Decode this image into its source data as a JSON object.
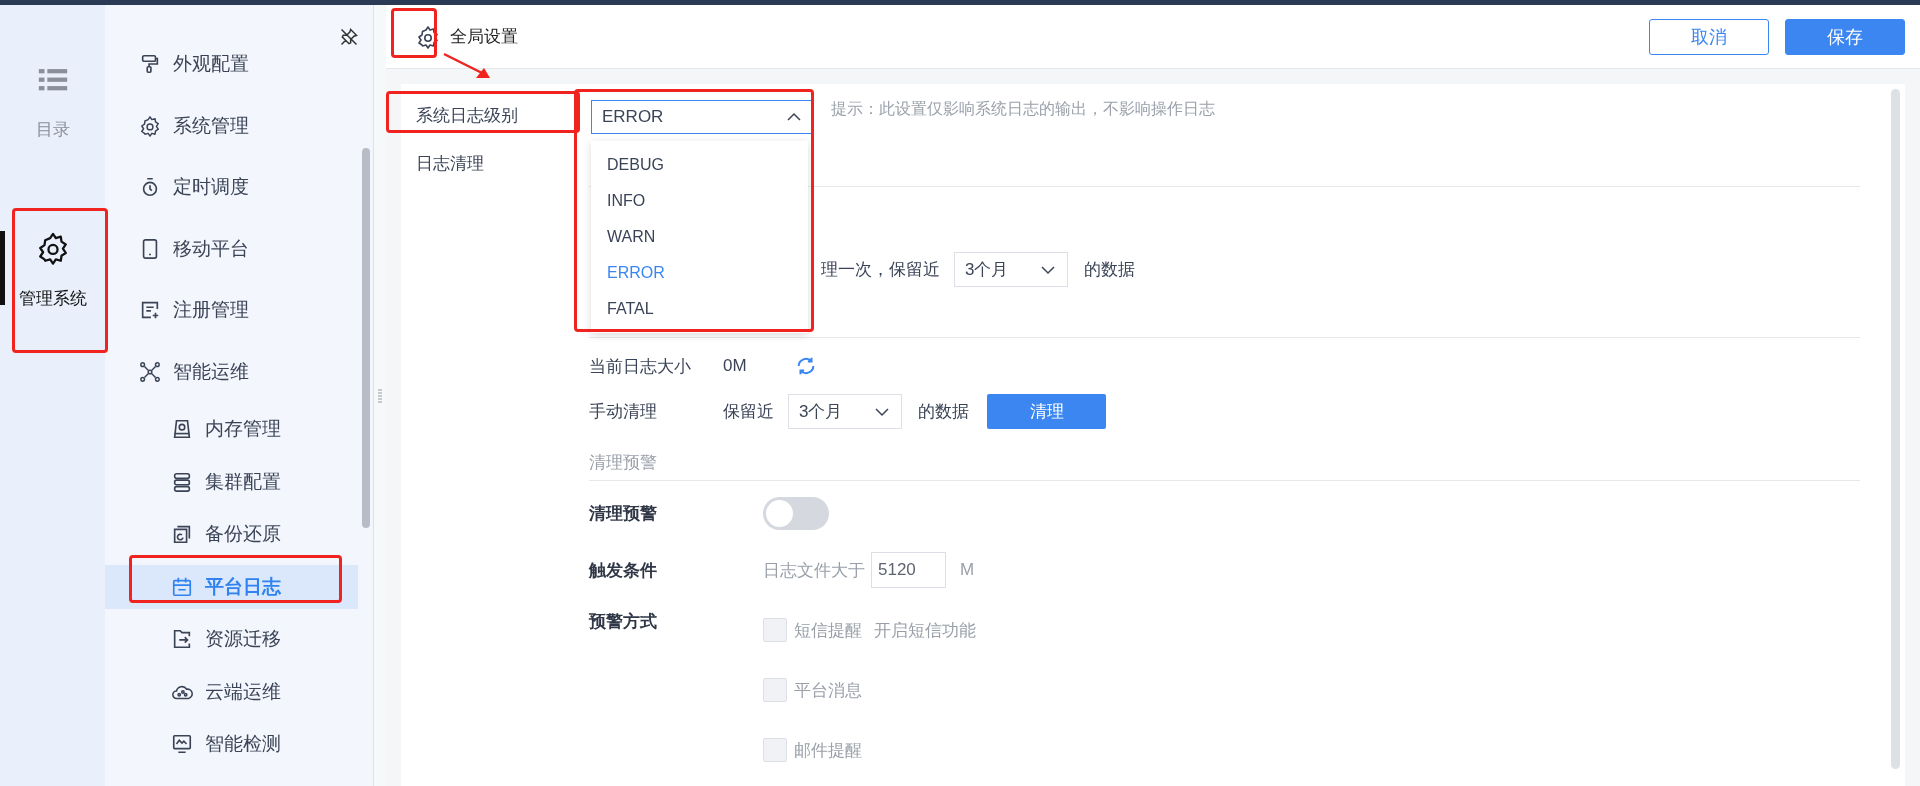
{
  "rail": {
    "items": [
      {
        "label": "目录",
        "selected": false
      },
      {
        "label": "管理系统",
        "selected": true
      }
    ]
  },
  "menu": {
    "items": [
      {
        "label": "外观配置",
        "selected": false
      },
      {
        "label": "系统管理",
        "selected": false
      },
      {
        "label": "定时调度",
        "selected": false
      },
      {
        "label": "移动平台",
        "selected": false
      },
      {
        "label": "注册管理",
        "selected": false
      },
      {
        "label": "智能运维",
        "selected": false,
        "children": [
          {
            "label": "内存管理",
            "selected": false
          },
          {
            "label": "集群配置",
            "selected": false
          },
          {
            "label": "备份还原",
            "selected": false
          },
          {
            "label": "平台日志",
            "selected": true
          },
          {
            "label": "资源迁移",
            "selected": false
          },
          {
            "label": "云端运维",
            "selected": false
          },
          {
            "label": "智能检测",
            "selected": false
          }
        ]
      }
    ]
  },
  "header": {
    "title": "全局设置",
    "buttons": [
      {
        "label": "取消",
        "kind": "secondary"
      },
      {
        "label": "保存",
        "kind": "primary"
      }
    ]
  },
  "nav": [
    {
      "label": "系统日志级别"
    },
    {
      "label": "日志清理"
    }
  ],
  "log_level": {
    "value": "ERROR",
    "expanded": true,
    "hint": "提示：此设置仅影响系统日志的输出，不影响操作日志",
    "options": [
      {
        "label": "DEBUG",
        "selected": false
      },
      {
        "label": "INFO",
        "selected": false
      },
      {
        "label": "WARN",
        "selected": false
      },
      {
        "label": "ERROR",
        "selected": true
      },
      {
        "label": "FATAL",
        "selected": false
      }
    ]
  },
  "auto_clean": {
    "text": "理一次，保留近",
    "period": "3个月",
    "suffix": "的数据"
  },
  "current_size": {
    "label": "当前日志大小",
    "value": "0M"
  },
  "manual_clean": {
    "label": "手动清理",
    "prefix": "保留近",
    "period": "3个月",
    "suffix": "的数据",
    "button": "清理"
  },
  "warning": {
    "section_title": "清理预警",
    "toggle": {
      "label": "清理预警",
      "on": false
    },
    "trigger": {
      "label": "触发条件",
      "prefix": "日志文件大于",
      "value": "5120",
      "unit": "M"
    },
    "methods": {
      "label": "预警方式",
      "options": [
        {
          "label": "短信提醒",
          "checked": false,
          "disabled": true,
          "link": "开启短信功能"
        },
        {
          "label": "平台消息",
          "checked": false,
          "disabled": true
        },
        {
          "label": "邮件提醒",
          "checked": false,
          "disabled": true
        }
      ]
    }
  }
}
